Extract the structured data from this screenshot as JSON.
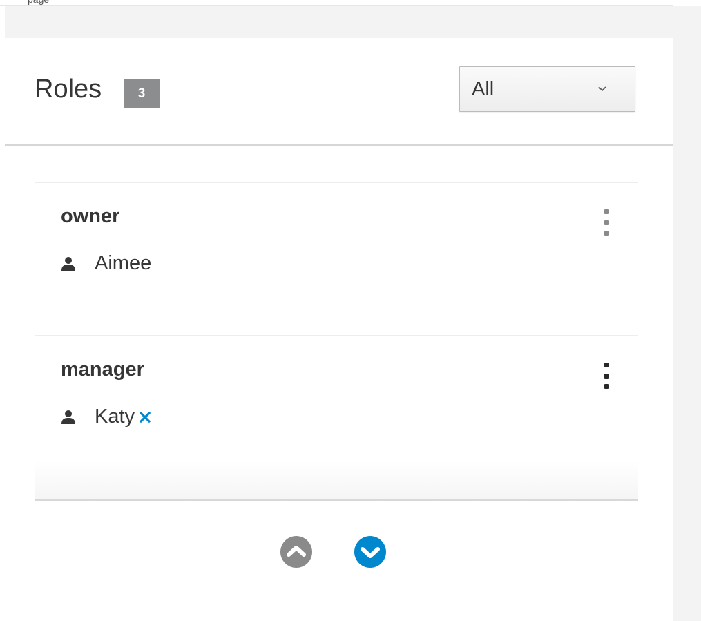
{
  "page": {
    "cut_off_text": "page"
  },
  "roles_panel": {
    "title": "Roles",
    "count": "3",
    "filter": {
      "selected": "All",
      "icon": "chevron-down-icon"
    },
    "roles": [
      {
        "name": "owner",
        "members": [
          {
            "name": "Aimee",
            "removable": false
          }
        ],
        "actions_enabled": false
      },
      {
        "name": "manager",
        "members": [
          {
            "name": "Katy",
            "removable": true
          }
        ],
        "actions_enabled": true
      }
    ],
    "pagination": {
      "previous": {
        "icon": "chevron-up-circle-icon",
        "enabled": false
      },
      "next": {
        "icon": "chevron-down-circle-icon",
        "enabled": true
      }
    }
  },
  "colors": {
    "accent": "#0088ce",
    "badge": "#8b8d8f",
    "disabled": "#8a8a8a",
    "text": "#363636"
  }
}
